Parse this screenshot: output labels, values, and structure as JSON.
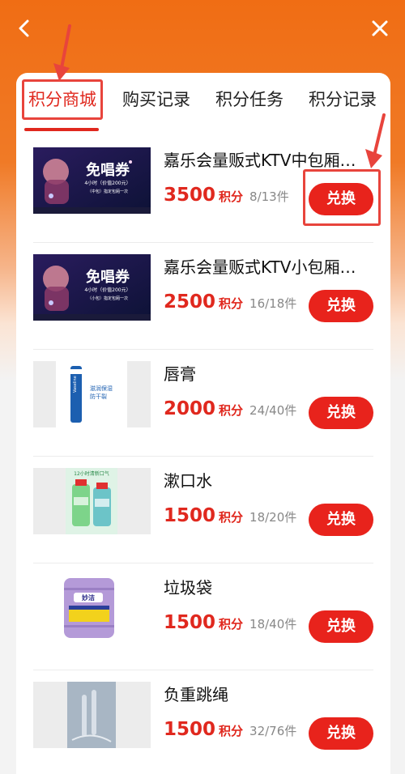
{
  "tabs": [
    {
      "label": "积分商城"
    },
    {
      "label": "购买记录"
    },
    {
      "label": "积分任务"
    },
    {
      "label": "积分记录"
    }
  ],
  "unit_label": "积分",
  "button_label": "兑换",
  "items": [
    {
      "name": "嘉乐会量贩式KTV中包厢…",
      "price": "3500",
      "stock": "8/13件",
      "thumb": "ktv-voucher"
    },
    {
      "name": "嘉乐会量贩式KTV小包厢…",
      "price": "2500",
      "stock": "16/18件",
      "thumb": "ktv-voucher"
    },
    {
      "name": "唇膏",
      "price": "2000",
      "stock": "24/40件",
      "thumb": "lip-balm"
    },
    {
      "name": "漱口水",
      "price": "1500",
      "stock": "18/20件",
      "thumb": "mouthwash"
    },
    {
      "name": "垃圾袋",
      "price": "1500",
      "stock": "18/40件",
      "thumb": "trash-bags"
    },
    {
      "name": "负重跳绳",
      "price": "1500",
      "stock": "32/76件",
      "thumb": "jump-rope"
    }
  ],
  "voucher": {
    "title": "免唱券",
    "line1": "4小时（价值200元）",
    "line2_mid": "（中包）指定包厢一次",
    "line2_small": "（小包）指定包厢一次"
  },
  "lip_balm_text": {
    "line1": "滋润保湿",
    "line2": "防干裂"
  },
  "mouthwash_text": "12小时清新口气",
  "trash_text": "妙洁",
  "colors": {
    "accent": "#e0281e",
    "header": "#f06d14",
    "annotation": "#e8443c"
  },
  "icons": {
    "back": "chevron-left-icon",
    "close": "close-icon"
  }
}
